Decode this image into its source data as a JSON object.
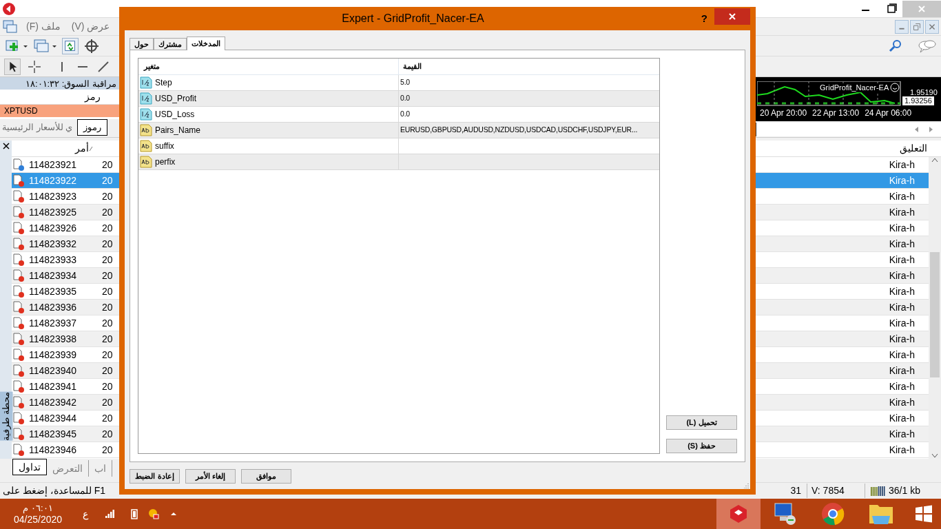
{
  "menu": [
    {
      "label": "عرض (V)"
    },
    {
      "label": "ملف (F)"
    }
  ],
  "market_watch": {
    "title": "مراقبة السوق: ١٨:٠١:٣٢",
    "column": "رمز",
    "rows": [
      {
        "symbol": "XPTUSD",
        "selected": true
      }
    ],
    "tabs": [
      {
        "label": "رموز",
        "selected": true
      },
      {
        "label": "ي للأسعار الرئيسية",
        "selected": false
      }
    ]
  },
  "chart": {
    "ea_label": "GridProfit_Nacer-EA",
    "prices": [
      "1.95190",
      "1.93256"
    ],
    "time_labels": [
      "20 Apr 20:00",
      "22 Apr 13:00",
      "24 Apr 06:00"
    ]
  },
  "terminal": {
    "title": "محطة طرفية",
    "columns": [
      "التعليق",
      "أمر"
    ],
    "rows": [
      {
        "order": "114823921",
        "column_2": "20",
        "comment": "Kira-h",
        "color": "#2f7fd8",
        "selected": false
      },
      {
        "order": "114823922",
        "column_2": "20",
        "comment": "Kira-h",
        "color": "#e0301e",
        "selected": true
      },
      {
        "order": "114823923",
        "column_2": "20",
        "comment": "Kira-h",
        "color": "#e0301e",
        "selected": false
      },
      {
        "order": "114823925",
        "column_2": "20",
        "comment": "Kira-h",
        "color": "#e0301e",
        "selected": false
      },
      {
        "order": "114823926",
        "column_2": "20",
        "comment": "Kira-h",
        "color": "#e0301e",
        "selected": false
      },
      {
        "order": "114823932",
        "column_2": "20",
        "comment": "Kira-h",
        "color": "#e0301e",
        "selected": false
      },
      {
        "order": "114823933",
        "column_2": "20",
        "comment": "Kira-h",
        "color": "#e0301e",
        "selected": false
      },
      {
        "order": "114823934",
        "column_2": "20",
        "comment": "Kira-h",
        "color": "#e0301e",
        "selected": false
      },
      {
        "order": "114823935",
        "column_2": "20",
        "comment": "Kira-h",
        "color": "#e0301e",
        "selected": false
      },
      {
        "order": "114823936",
        "column_2": "20",
        "comment": "Kira-h",
        "color": "#e0301e",
        "selected": false
      },
      {
        "order": "114823937",
        "column_2": "20",
        "comment": "Kira-h",
        "color": "#e0301e",
        "selected": false
      },
      {
        "order": "114823938",
        "column_2": "20",
        "comment": "Kira-h",
        "color": "#e0301e",
        "selected": false
      },
      {
        "order": "114823939",
        "column_2": "20",
        "comment": "Kira-h",
        "color": "#e0301e",
        "selected": false
      },
      {
        "order": "114823940",
        "column_2": "20",
        "comment": "Kira-h",
        "color": "#e0301e",
        "selected": false
      },
      {
        "order": "114823941",
        "column_2": "20",
        "comment": "Kira-h",
        "color": "#e0301e",
        "selected": false
      },
      {
        "order": "114823942",
        "column_2": "20",
        "comment": "Kira-h",
        "color": "#e0301e",
        "selected": false
      },
      {
        "order": "114823944",
        "column_2": "20",
        "comment": "Kira-h",
        "color": "#e0301e",
        "selected": false
      },
      {
        "order": "114823945",
        "column_2": "20",
        "comment": "Kira-h",
        "color": "#e0301e",
        "selected": false
      },
      {
        "order": "114823946",
        "column_2": "20",
        "comment": "Kira-h",
        "color": "#e0301e",
        "selected": false
      }
    ],
    "tabs": [
      {
        "label": "اب",
        "selected": false
      },
      {
        "label": "التعرض",
        "selected": false
      },
      {
        "label": "تداول",
        "selected": true
      }
    ]
  },
  "status_bar": {
    "help": "للمساعدة، إضغط على F1",
    "field_1": "31",
    "volume": "V: 7854",
    "traffic": "36/1 kb"
  },
  "taskbar": {
    "time": "٠٦:٠١ م",
    "date": "04/25/2020",
    "language": "ع"
  },
  "dialog": {
    "title": "Expert - GridProfit_Nacer-EA",
    "help": "?",
    "tabs": [
      {
        "label": "المدخلات",
        "selected": true
      },
      {
        "label": "مشترك",
        "selected": false
      },
      {
        "label": "حول",
        "selected": false
      }
    ],
    "columns": [
      "القيمة",
      "متغير"
    ],
    "params": [
      {
        "kind": "number",
        "name": "Step",
        "value": "5.0"
      },
      {
        "kind": "number",
        "name": "USD_Profit",
        "value": "0.0"
      },
      {
        "kind": "number",
        "name": "USD_Loss",
        "value": "0.0"
      },
      {
        "kind": "text",
        "name": "Pairs_Name",
        "value": "EURUSD,GBPUSD,AUDUSD,NZDUSD,USDCAD,USDCHF,USDJPY,EUR..."
      },
      {
        "kind": "text",
        "name": "suffix"
      },
      {
        "kind": "text",
        "name": "perfix"
      }
    ],
    "side_buttons": [
      "تحميل (L)",
      "حفظ (S)"
    ],
    "buttons": [
      "موافق",
      "إلغاء الأمر",
      "إعادة الضبط"
    ]
  }
}
